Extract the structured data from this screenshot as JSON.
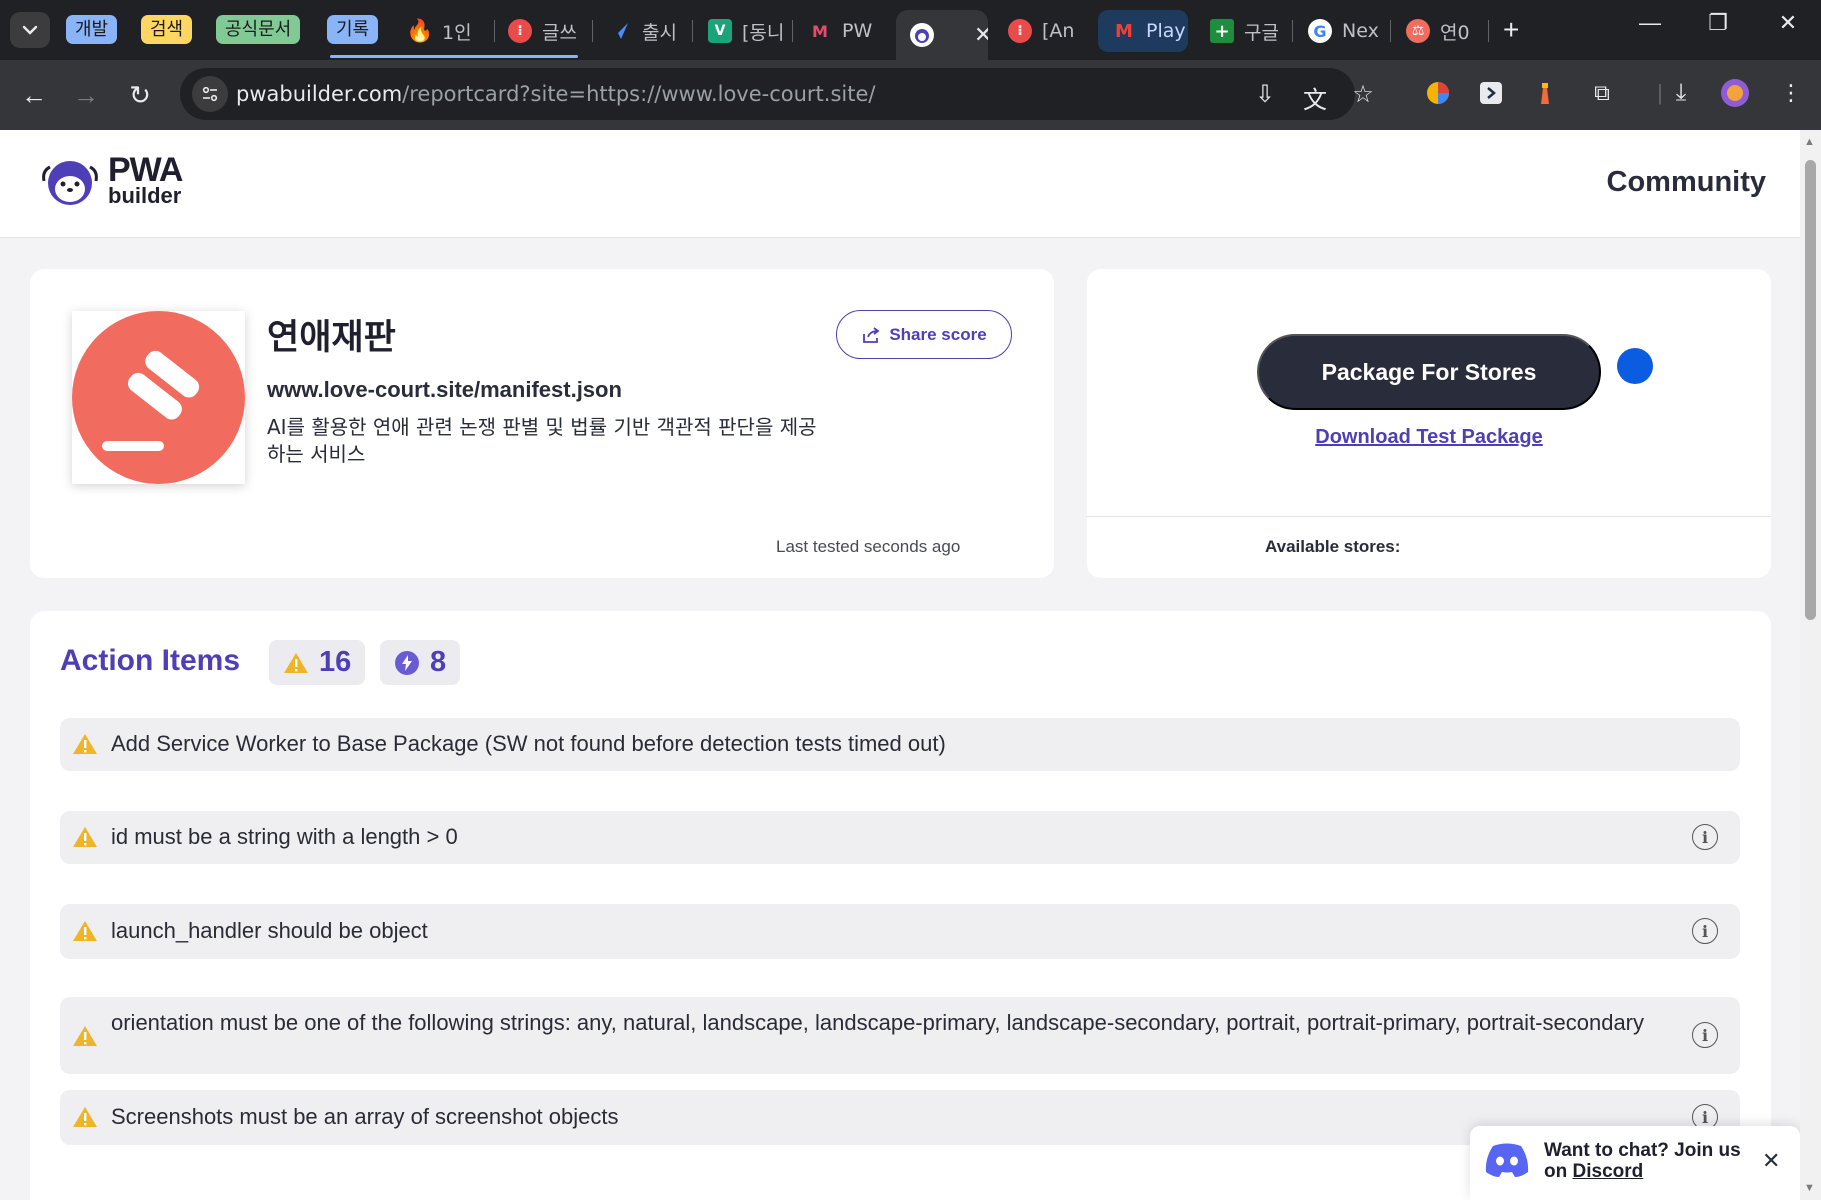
{
  "browser": {
    "tab_groups": [
      {
        "label": "개발",
        "color": "#8ab4f8"
      },
      {
        "label": "검색",
        "color": "#fdd663"
      },
      {
        "label": "공식문서",
        "color": "#81c995"
      },
      {
        "label": "기록",
        "color": "#8ab4f8"
      }
    ],
    "tabs": [
      {
        "title": "1인",
        "icon": "fire-icon"
      },
      {
        "title": "글쓰",
        "icon": "red-circle-icon"
      },
      {
        "title": "출시",
        "icon": "arrow-app-icon"
      },
      {
        "title": "[동니",
        "icon": "v-app-icon"
      },
      {
        "title": "PW",
        "icon": "pwa-m-icon"
      },
      {
        "title": "",
        "icon": "pwabuilder-otter-icon",
        "active": true
      },
      {
        "title": "[An",
        "icon": "red-circle-icon"
      },
      {
        "title": "Play",
        "icon": "gmail-icon"
      },
      {
        "title": "구글",
        "icon": "sheets-icon"
      },
      {
        "title": "Nex",
        "icon": "google-icon"
      },
      {
        "title": "연0",
        "icon": "gavel-app-icon"
      }
    ],
    "url_host": "pwabuilder.com",
    "url_path": "/reportcard?site=https://www.love-court.site/"
  },
  "site": {
    "logo_big": "PWA",
    "logo_small": "builder",
    "nav_community": "Community"
  },
  "app": {
    "name": "연애재판",
    "manifest_url": "www.love-court.site/manifest.json",
    "description": "AI를 활용한 연애 관련 논쟁 판별 및 법률 기반 객관적 판단을 제공하는 서비스",
    "share_label": "Share score",
    "last_tested": "Last tested seconds ago",
    "icon_color": "#f26b5f"
  },
  "package": {
    "button_label": "Package For Stores",
    "download_test_label": "Download Test Package",
    "available_stores_label": "Available stores:"
  },
  "action_items": {
    "title": "Action Items",
    "warning_count": "16",
    "suggestion_count": "8",
    "items": [
      {
        "text": "Add Service Worker to Base Package (SW not found before detection tests timed out)",
        "has_info": false
      },
      {
        "text": "id must be a string with a length > 0",
        "has_info": true
      },
      {
        "text": "launch_handler should be object",
        "has_info": true
      },
      {
        "text": "orientation must be one of the following strings: any, natural, landscape, landscape-primary, landscape-secondary, portrait, portrait-primary, portrait-secondary",
        "has_info": true
      },
      {
        "text": "Screenshots must be an array of screenshot objects",
        "has_info": true
      }
    ]
  },
  "discord": {
    "text_prefix": "Want to chat? Join us on",
    "link_text": "Discord"
  },
  "colors": {
    "brand": "#4f3fb6",
    "dark": "#292c3a",
    "warning": "#f0b429"
  }
}
